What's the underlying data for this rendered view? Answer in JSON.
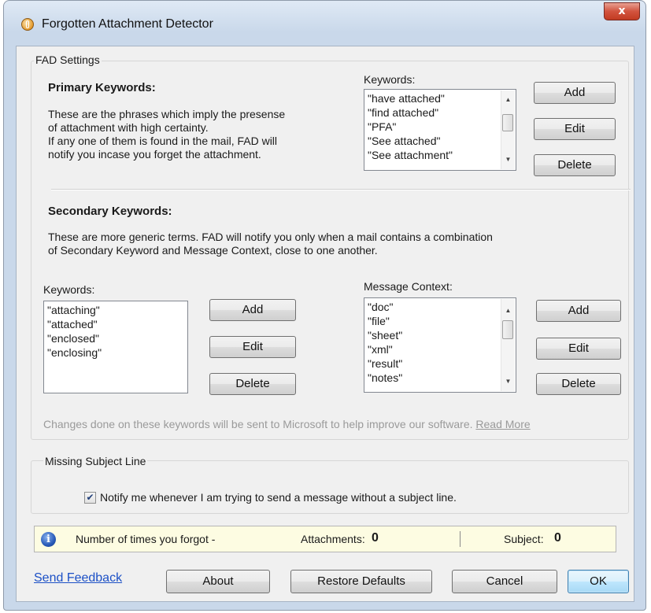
{
  "window": {
    "title": "Forgotten Attachment Detector",
    "close_glyph": "x"
  },
  "fad_settings": {
    "group_label": "FAD Settings",
    "primary": {
      "heading": "Primary Keywords:",
      "description": [
        "These are the phrases which imply the presense",
        "of attachment with high certainty.",
        "If any one of them is found in the mail, FAD will",
        "notify you incase you forget the attachment."
      ],
      "list_label": "Keywords:",
      "keywords": [
        "\"have attached\"",
        "\"find attached\"",
        "\"PFA\"",
        "\"See attached\"",
        "\"See attachment\""
      ],
      "add_label": "Add",
      "edit_label": "Edit",
      "delete_label": "Delete"
    },
    "secondary": {
      "heading": "Secondary Keywords:",
      "description": [
        "These are more generic terms. FAD will notify you only when a mail contains a combination",
        "of Secondary Keyword and Message Context, close to one another."
      ],
      "keywords_label": "Keywords:",
      "keywords": [
        "\"attaching\"",
        "\"attached\"",
        "\"enclosed\"",
        "\"enclosing\""
      ],
      "context_label": "Message Context:",
      "context": [
        "\"doc\"",
        "\"file\"",
        "\"sheet\"",
        "\"xml\"",
        "\"result\"",
        "\"notes\""
      ],
      "add_label": "Add",
      "edit_label": "Edit",
      "delete_label": "Delete"
    },
    "note": "Changes done on these keywords will be sent to Microsoft to help improve our software.",
    "read_more": "Read More"
  },
  "subject": {
    "group_label": "Missing Subject Line",
    "checkbox_label": "Notify me whenever I am trying to send a message without a subject line.",
    "checked": true
  },
  "stats": {
    "label": "Number of times you forgot -",
    "attachments_label": "Attachments:",
    "attachments_value": "0",
    "subject_label": "Subject:",
    "subject_value": "0"
  },
  "footer": {
    "feedback_link": "Send Feedback",
    "about": "About",
    "restore": "Restore Defaults",
    "cancel": "Cancel",
    "ok": "OK"
  },
  "icons": {
    "app": "app-icon",
    "info": "info-icon"
  }
}
